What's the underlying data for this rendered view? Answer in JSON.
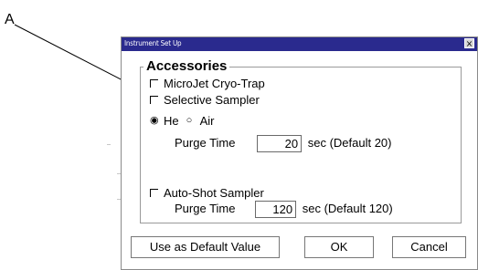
{
  "annotation": {
    "label": "A"
  },
  "dialog": {
    "title": "Instrument Set Up",
    "close_glyph": "×",
    "group_title": "Accessories",
    "accessories": [
      {
        "label": "MicroJet Cryo-Trap"
      },
      {
        "label": "Selective Sampler"
      }
    ],
    "carrier": {
      "radio_glyph_selected": "◉",
      "radio_glyph_unselected": "○",
      "he_label": "He",
      "air_label": "Air",
      "selected": "He"
    },
    "selective_purge": {
      "label": "Purge Time",
      "value": "20",
      "suffix": "sec (Default 20)"
    },
    "autoshot": {
      "label": "Auto-Shot Sampler",
      "purge_label": "Purge Time",
      "purge_value": "120",
      "purge_suffix": "sec (Default 120)"
    },
    "buttons": {
      "default": "Use as Default Value",
      "ok": "OK",
      "cancel": "Cancel"
    }
  }
}
